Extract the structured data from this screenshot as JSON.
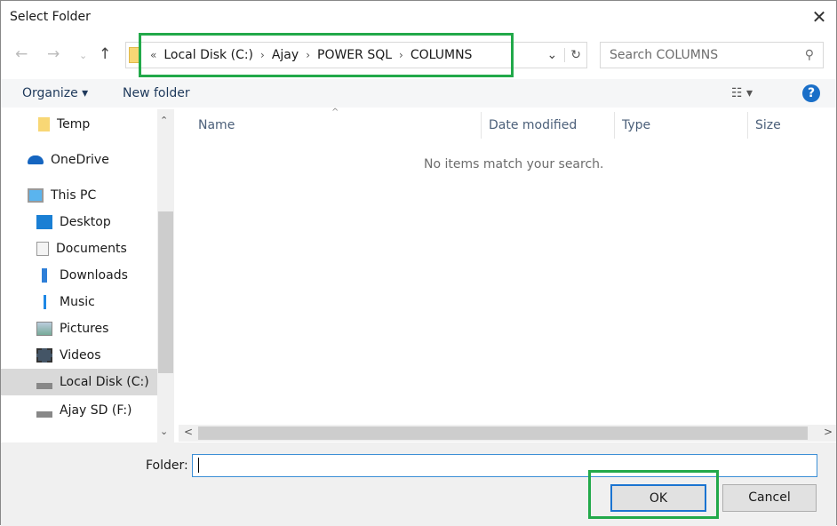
{
  "window": {
    "title": "Select Folder"
  },
  "address": {
    "crumbs": [
      "Local Disk (C:)",
      "Ajay",
      "POWER SQL",
      "COLUMNS"
    ]
  },
  "search": {
    "placeholder": "Search COLUMNS"
  },
  "toolbar": {
    "organize": "Organize ▾",
    "new_folder": "New folder",
    "help": "?"
  },
  "sidebar": {
    "items": [
      {
        "label": "Temp",
        "icon": "folder-icon"
      },
      {
        "label": "OneDrive",
        "icon": "cloud-icon"
      },
      {
        "label": "This PC",
        "icon": "computer-icon"
      },
      {
        "label": "Desktop",
        "icon": "desktop-icon"
      },
      {
        "label": "Documents",
        "icon": "documents-icon"
      },
      {
        "label": "Downloads",
        "icon": "download-icon"
      },
      {
        "label": "Music",
        "icon": "music-icon"
      },
      {
        "label": "Pictures",
        "icon": "pictures-icon"
      },
      {
        "label": "Videos",
        "icon": "videos-icon"
      },
      {
        "label": "Local Disk (C:)",
        "icon": "drive-icon",
        "selected": true
      },
      {
        "label": "Ajay SD (F:)",
        "icon": "drive-icon"
      }
    ]
  },
  "columns": [
    "Name",
    "Date modified",
    "Type",
    "Size"
  ],
  "empty_message": "No items match your search.",
  "footer": {
    "folder_label": "Folder:",
    "folder_value": "",
    "ok": "OK",
    "cancel": "Cancel"
  },
  "colors": {
    "highlight": "#22a94a",
    "accent": "#1b74d1"
  }
}
